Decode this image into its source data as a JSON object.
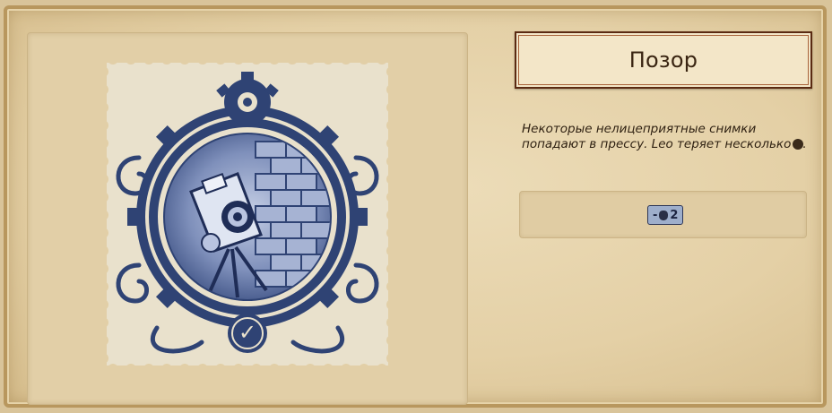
{
  "event": {
    "title": "Позор",
    "description_prefix": "Некоторые нелицеприятные снимки попадают в прессу. Leo теряет несколько",
    "description_suffix": ".",
    "effect": {
      "sign": "-",
      "value": "2",
      "icon": "reputation-hand-icon"
    },
    "stamp_image": "camera-stamp-illustration",
    "stamp_status_icon": "checkmark-icon"
  },
  "colors": {
    "stamp_ink": "#2f4374",
    "stamp_paper": "#e9e1cc",
    "title_border": "#5a2a12",
    "badge_bg": "#9eaecb"
  }
}
